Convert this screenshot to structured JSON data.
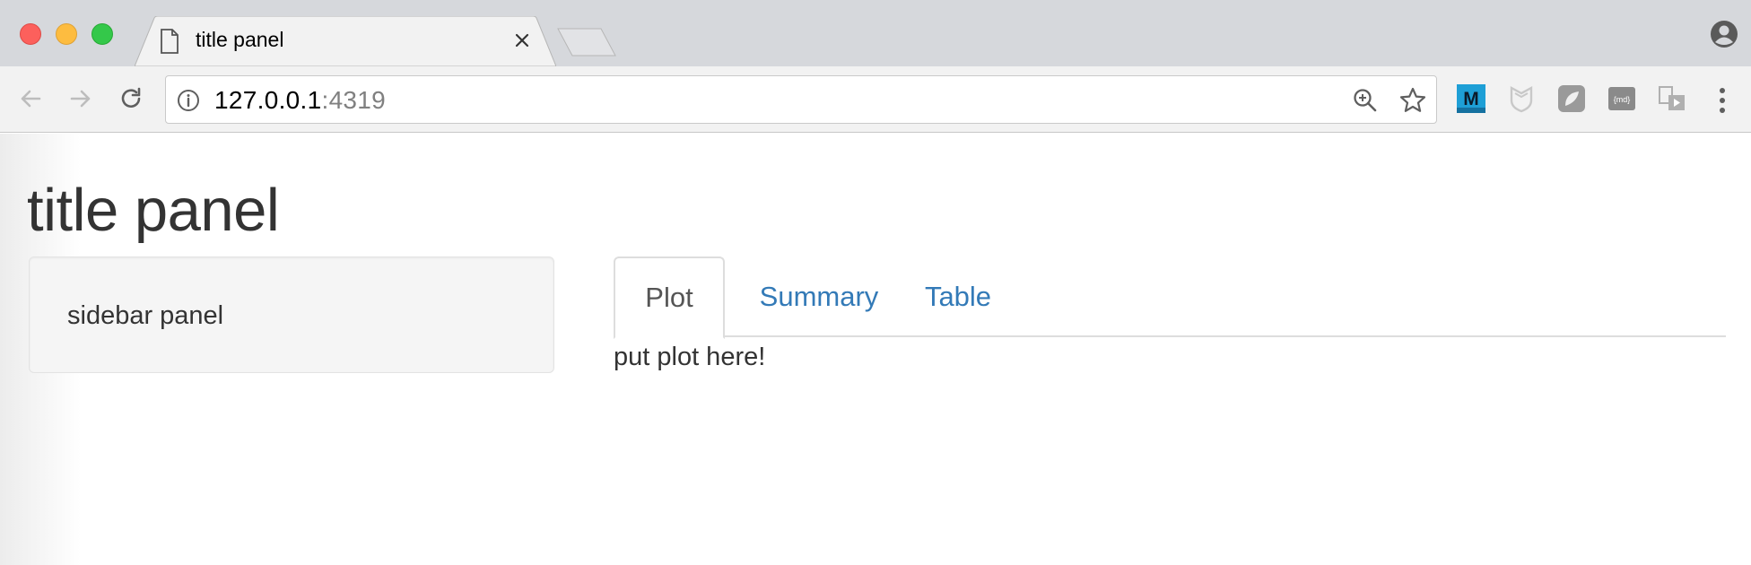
{
  "browser": {
    "tab": {
      "title": "title panel"
    },
    "address_bar": {
      "host": "127.0.0.1",
      "port": ":4319"
    },
    "icons": {
      "back": "back-arrow-icon",
      "forward": "forward-arrow-icon",
      "reload": "reload-icon",
      "info": "info-icon",
      "zoom": "zoom-in-icon",
      "bookmark": "star-icon",
      "profile": "profile-icon",
      "menu": "more-vertical-icon"
    },
    "extensions": [
      {
        "name": "m-extension-icon",
        "label": "M",
        "color": "#1e9fd6"
      },
      {
        "name": "shield-extension-icon",
        "color": "#c8c8c8"
      },
      {
        "name": "grey-badge-extension-icon",
        "color": "#9a9a9a"
      },
      {
        "name": "markdown-extension-icon",
        "label": "{md}",
        "color": "#8a8a8a"
      },
      {
        "name": "cast-extension-icon",
        "color": "#b0b0b0"
      }
    ]
  },
  "page": {
    "title": "title panel",
    "sidebar": {
      "text": "sidebar panel"
    },
    "tabs": [
      {
        "label": "Plot",
        "active": true
      },
      {
        "label": "Summary",
        "active": false
      },
      {
        "label": "Table",
        "active": false
      }
    ],
    "tab_content": "put plot here!"
  },
  "colors": {
    "link": "#337ab7",
    "active_tab_text": "#555555",
    "text": "#333333"
  }
}
